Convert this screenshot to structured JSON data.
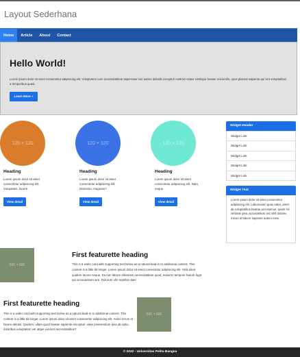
{
  "header": {
    "title": "Layout Sederhana"
  },
  "nav": {
    "items": [
      "Home",
      "Article",
      "About",
      "Contact"
    ]
  },
  "jumbotron": {
    "title": "Hello World!",
    "text": "Lorem ipsum dolor sit amet consectetur adipisicing elit. Voluptatem eum necessitatibus aspernatur nisi autem deleniti excepturi nostrum natus similique beatae reiciendis, quos placeat sapiente qui sint voluptatibus a temporibus quasi.",
    "button": "Learn More »"
  },
  "columns": [
    {
      "image_text": "120 × 120",
      "heading": "Heading",
      "text": "Lorem ipsum dolor sit amet consectetur adipisicing elit. Voluptates, facere.",
      "button": "View detail",
      "color": "#d97d2c"
    },
    {
      "image_text": "120 × 120",
      "heading": "Heading",
      "text": "Lorem ipsum dolor sit amet consectetur adipisicing elit. Distinctio, magnam?",
      "button": "View detail",
      "color": "#3b72e6"
    },
    {
      "image_text": "120 × 120",
      "heading": "Heading",
      "text": "Lorem ipsum dolor sit amet consectetur adipisicing elit. Nam, neque.",
      "button": "View detail",
      "color": "#6ee8d2"
    }
  ],
  "widgets": {
    "header": "Widget Header",
    "links": [
      "Widget Link",
      "Widget Link",
      "Widget Link",
      "Widget Link",
      "Widget Link"
    ],
    "text_header": "Widget Text",
    "text": "Lorem ipsum dolor sit amet consectetur adipisicing elit. Laboriosam quas natur, amet ab voluptatibus beatae accusamus, quam hic veritatis ipsa, accusantium est nihil dolores minus at labore sapiente autem esse."
  },
  "featurettes": [
    {
      "image_text": "500 × 500",
      "heading": "First featurette heading",
      "text": "This is a wider card with supporting text below as a natural lead-in to additional content. This content is a little bit longer. Lorem ipsum dolor sit amet consectetur adipisicing elit. Velit amet quidem facere neque. Ea non labore doloresm necessitatibus quod, maiores tempore harum fugit qui accusantium iure. Dolorum ullo repellat utae!"
    },
    {
      "image_text": "500 × 500",
      "heading": "First featurette heading",
      "text": "This is a wider card with supporting text below as a natural lead-in to additional content. This content is a little bit longer. Lorem ipsum dolor sit amet consectetur adipisicing elit. Animi rerum et facere debitis. Quidem, ullam quod beatae sapiente excepturi, vitae praesentium ipsa ab optio, doloribus voluptatem vel atque eveniet necessitatibus?"
    }
  ],
  "footer": {
    "text": "© 2022 - Universitas Pelita Bangsa"
  }
}
